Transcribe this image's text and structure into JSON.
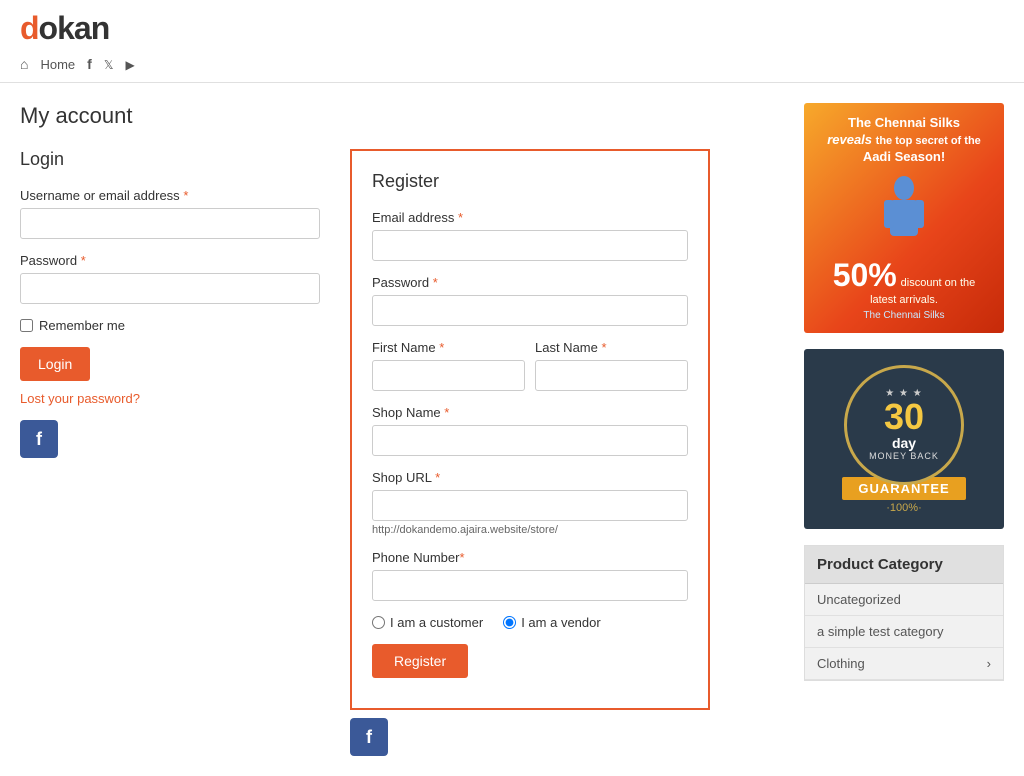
{
  "logo": {
    "d": "d",
    "rest": "okan"
  },
  "nav": {
    "home": "Home",
    "icons": [
      "home-icon",
      "facebook-icon",
      "twitter-icon",
      "youtube-icon"
    ]
  },
  "page": {
    "title": "My account"
  },
  "login": {
    "section_title": "Login",
    "username_label": "Username or email address",
    "username_required": "*",
    "password_label": "Password",
    "password_required": "*",
    "remember_label": "Remember me",
    "login_button": "Login",
    "lost_password": "Lost your password?",
    "fb_label": "f"
  },
  "register": {
    "section_title": "Register",
    "email_label": "Email address",
    "email_required": "*",
    "password_label": "Password",
    "password_required": "*",
    "first_name_label": "First Name",
    "first_name_required": "*",
    "last_name_label": "Last Name",
    "last_name_required": "*",
    "shop_name_label": "Shop Name",
    "shop_name_required": "*",
    "shop_url_label": "Shop URL",
    "shop_url_required": "*",
    "shop_url_hint": "http://dokandemo.ajaira.website/store/",
    "phone_label": "Phone Number",
    "phone_required": "*",
    "customer_radio": "I am a customer",
    "vendor_radio": "I am a vendor",
    "register_button": "Register",
    "fb_label": "f"
  },
  "sidebar": {
    "ad": {
      "title": "The Chennai Silks",
      "reveals": "reveals",
      "top_secret": "the top secret of the",
      "season": "Aadi Season!",
      "discount": "50%",
      "discount_label": "discount on the",
      "arrivals": "latest arrivals.",
      "brand": "The Chennai Silks"
    },
    "guarantee": {
      "days": "30",
      "day": "day",
      "money_back": "MONEY BACK",
      "guarantee": "GUARANTEE",
      "percent": "·100%·"
    },
    "product_category": {
      "title": "Product Category",
      "items": [
        {
          "label": "Uncategorized",
          "has_arrow": false
        },
        {
          "label": "a simple test category",
          "has_arrow": false
        },
        {
          "label": "Clothing",
          "has_arrow": true
        }
      ]
    }
  }
}
